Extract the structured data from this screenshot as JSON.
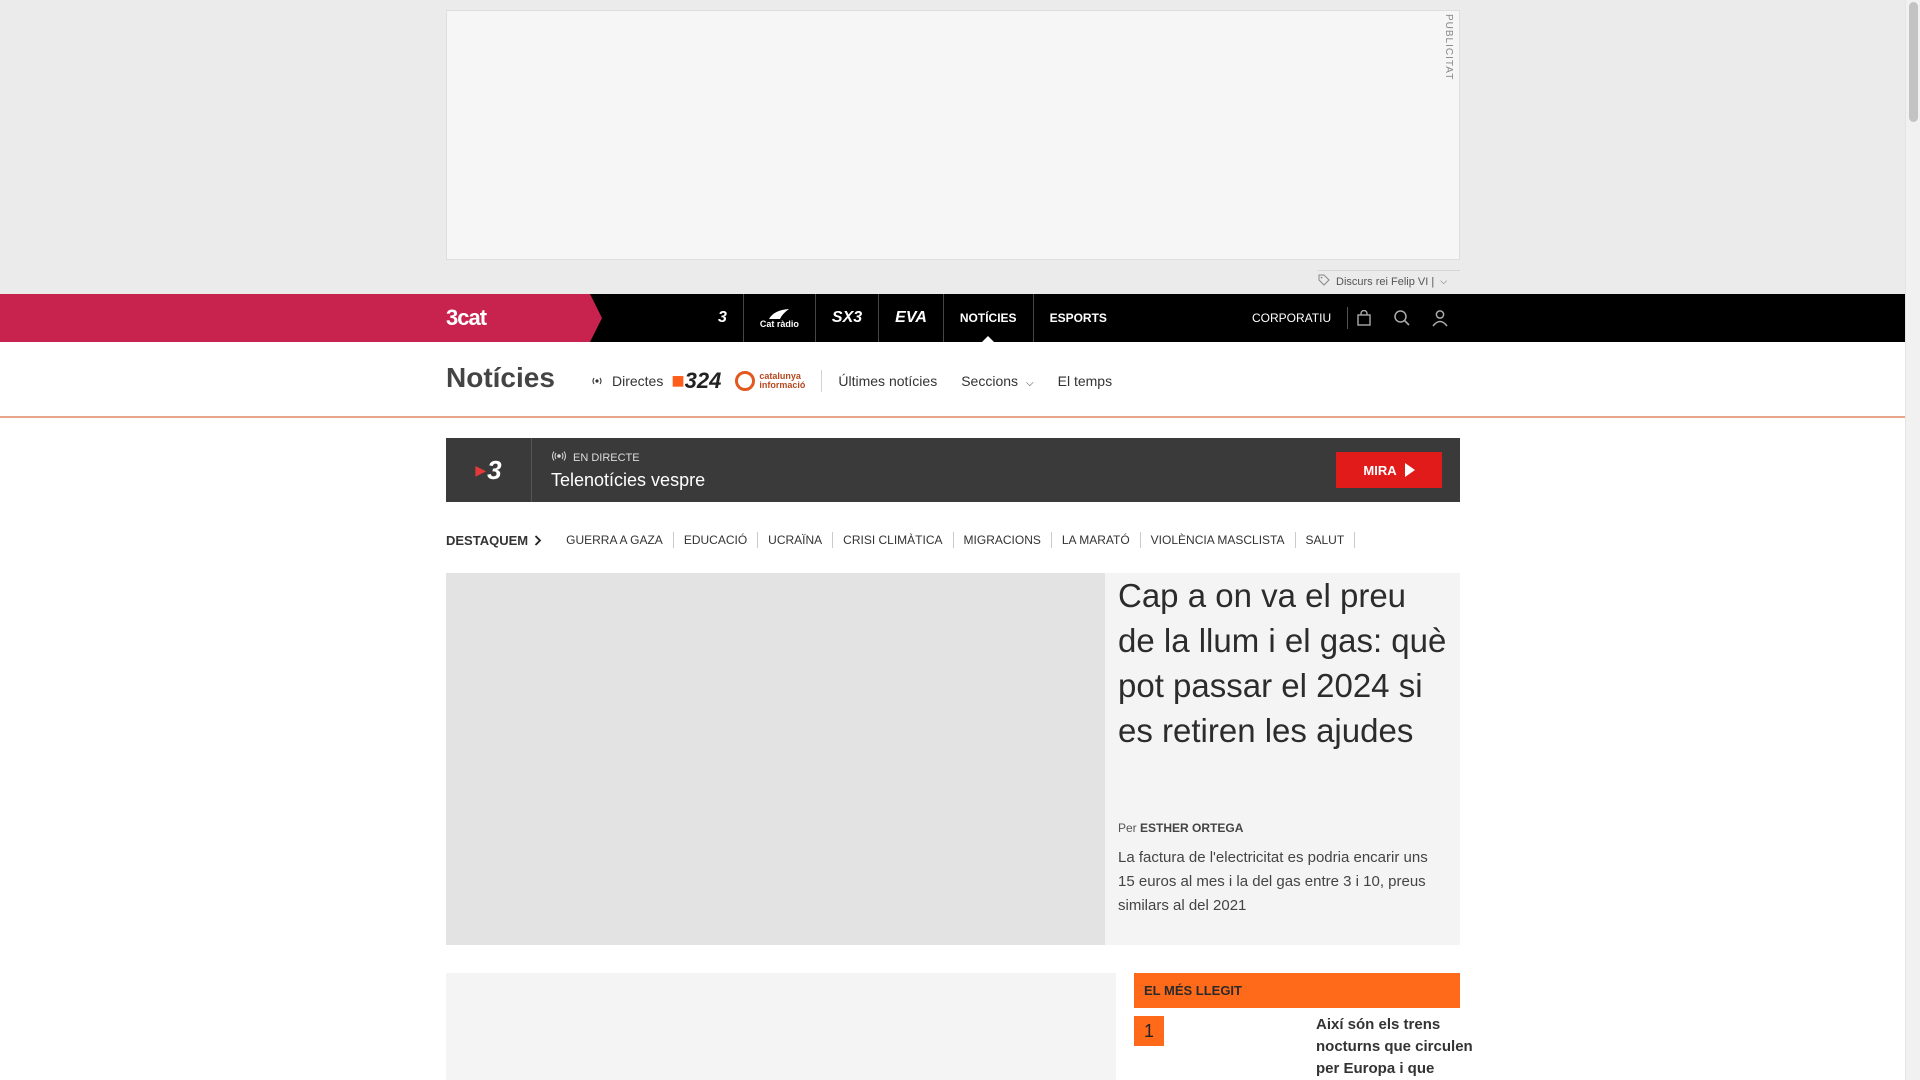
{
  "ad": {
    "label": "PUBLICITAT"
  },
  "trend": {
    "text": "Discurs rei Felip VI |"
  },
  "topnav": {
    "logo": "3cat",
    "channels": [
      {
        "label": "3"
      },
      {
        "label": "Cat ràdio"
      },
      {
        "label": "SX3"
      },
      {
        "label": "EVA"
      }
    ],
    "links": [
      {
        "label": "NOTÍCIES"
      },
      {
        "label": "ESPORTS"
      }
    ],
    "corporate": "CORPORATIU"
  },
  "section": {
    "title": "Notícies",
    "directes": "Directes",
    "logo_324": "324",
    "catinfo_line1": "catalunya",
    "catinfo_line2": "informació",
    "links": [
      {
        "label": "Últimes notícies"
      },
      {
        "label": "Seccions"
      },
      {
        "label": "El temps"
      }
    ]
  },
  "live": {
    "channel": "3",
    "tag": "EN DIRECTE",
    "show": "Telenotícies vespre",
    "button": "MIRA"
  },
  "destaquem": {
    "head": "DESTAQUEM",
    "items": [
      {
        "label": "GUERRA A GAZA"
      },
      {
        "label": "EDUCACIÓ"
      },
      {
        "label": "UCRAÏNA"
      },
      {
        "label": "CRISI CLIMÀTICA"
      },
      {
        "label": "MIGRACIONS"
      },
      {
        "label": "LA MARATÓ"
      },
      {
        "label": "VIOLÈNCIA MASCLISTA"
      },
      {
        "label": "SALUT"
      }
    ]
  },
  "hero": {
    "title": "Cap a on va el preu de la llum i el gas: què pot passar el 2024 si es retiren les ajudes",
    "by_prefix": "Per",
    "author": "ESTHER ORTEGA",
    "desc": "La factura de l'electricitat es podria encarir uns 15 euros al mes i la del gas entre 3 i 10, preus similars al del 2021"
  },
  "mes_llegit": {
    "heading": "EL MÉS LLEGIT",
    "items": [
      {
        "rank": "1",
        "title": "Així són els trens nocturns que circulen per Europa i que"
      }
    ]
  },
  "colors": {
    "brand": "#c8234e",
    "accent_orange": "#ff6a1a",
    "live_red": "#e11a1a"
  }
}
